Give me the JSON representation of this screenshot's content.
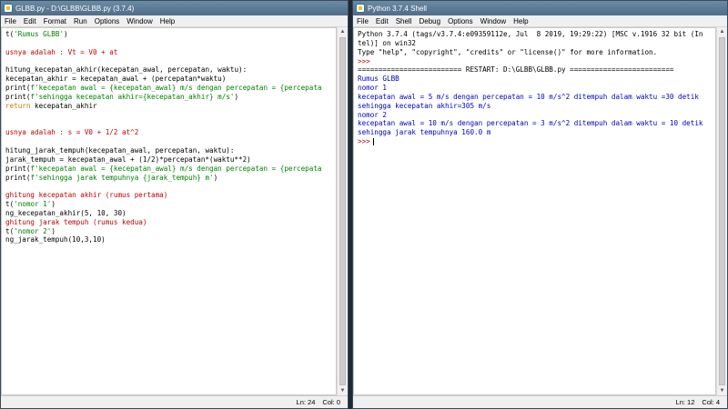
{
  "editor_window": {
    "title": "GLBB.py - D:\\GLBB\\GLBB.py (3.7.4)",
    "menu": [
      "File",
      "Edit",
      "Format",
      "Run",
      "Options",
      "Window",
      "Help"
    ],
    "lines": [
      [
        {
          "t": "t(",
          "c": "def"
        },
        {
          "t": "'Rumus GLBB'",
          "c": "str"
        },
        {
          "t": ")",
          "c": "def"
        }
      ],
      [],
      [
        {
          "t": "usnya adalah : Vt = V0 + at",
          "c": "cmt"
        }
      ],
      [],
      [
        {
          "t": "hitung_kecepatan_akhir(kecepatan_awal, percepatan, waktu):",
          "c": "def"
        }
      ],
      [
        {
          "t": "kecepatan_akhir = kecepatan_awal + (percepatan*waktu)",
          "c": "def"
        }
      ],
      [
        {
          "t": "print(",
          "c": "def"
        },
        {
          "t": "f'kecepatan awal = {kecepatan_awal} m/s dengan percepatan = {percepata",
          "c": "str"
        }
      ],
      [
        {
          "t": "print(",
          "c": "def"
        },
        {
          "t": "f'sehingga kecepatan akhir={kecepatan_akhir} m/s'",
          "c": "str"
        },
        {
          "t": ")",
          "c": "def"
        }
      ],
      [
        {
          "t": "return",
          "c": "kw"
        },
        {
          "t": " kecepatan_akhir",
          "c": "def"
        }
      ],
      [],
      [],
      [
        {
          "t": "usnya adalah : s = V0 + 1/2 at^2",
          "c": "cmt"
        }
      ],
      [],
      [
        {
          "t": "hitung_jarak_tempuh(kecepatan_awal, percepatan, waktu):",
          "c": "def"
        }
      ],
      [
        {
          "t": "jarak_tempuh = kecepatan_awal + (1/2)*percepatan*(waktu**2)",
          "c": "def"
        }
      ],
      [
        {
          "t": "print(",
          "c": "def"
        },
        {
          "t": "f'kecepatan awal = {kecepatan_awal} m/s dengan percepatan = {percepata",
          "c": "str"
        }
      ],
      [
        {
          "t": "print(",
          "c": "def"
        },
        {
          "t": "f'sehingga jarak tempuhnya {jarak_tempuh} m'",
          "c": "str"
        },
        {
          "t": ")",
          "c": "def"
        }
      ],
      [],
      [
        {
          "t": "ghitung kecepatan akhir (rumus pertama)",
          "c": "cmt"
        }
      ],
      [
        {
          "t": "t(",
          "c": "def"
        },
        {
          "t": "'nomor 1'",
          "c": "str"
        },
        {
          "t": ")",
          "c": "def"
        }
      ],
      [
        {
          "t": "ng_kecepatan_akhir(5, 10, 30)",
          "c": "def"
        }
      ],
      [
        {
          "t": "ghitung jarak tempuh (rumus kedua)",
          "c": "cmt"
        }
      ],
      [
        {
          "t": "t(",
          "c": "def"
        },
        {
          "t": "'nomor 2'",
          "c": "str"
        },
        {
          "t": ")",
          "c": "def"
        }
      ],
      [
        {
          "t": "ng_jarak_tempuh(10,3,10)",
          "c": "def"
        }
      ]
    ],
    "status": {
      "ln": "Ln: 24",
      "col": "Col: 0"
    }
  },
  "shell_window": {
    "title": "Python 3.7.4 Shell",
    "menu": [
      "File",
      "Edit",
      "Shell",
      "Debug",
      "Options",
      "Window",
      "Help"
    ],
    "lines": [
      [
        {
          "t": "Python 3.7.4 (tags/v3.7.4:e09359112e, Jul  8 2019, 19:29:22) [MSC v.1916 32 bit (In",
          "c": "def"
        }
      ],
      [
        {
          "t": "tel)] on win32",
          "c": "def"
        }
      ],
      [
        {
          "t": "Type \"help\", \"copyright\", \"credits\" or \"license()\" for more information.",
          "c": "def"
        }
      ],
      [
        {
          "t": ">>>",
          "c": "prompt"
        }
      ],
      [
        {
          "t": "========================= RESTART: D:\\GLBB\\GLBB.py =========================",
          "c": "def"
        }
      ],
      [
        {
          "t": "Rumus GLBB",
          "c": "out"
        }
      ],
      [
        {
          "t": "nomor 1",
          "c": "out"
        }
      ],
      [
        {
          "t": "kecepatan awal = 5 m/s dengan percepatan = 10 m/s^2 ditempuh dalam waktu =30 detik",
          "c": "out"
        }
      ],
      [
        {
          "t": "sehingga kecepatan akhir=305 m/s",
          "c": "out"
        }
      ],
      [
        {
          "t": "nomor 2",
          "c": "out"
        }
      ],
      [
        {
          "t": "kecepatan awal = 10 m/s dengan percepatan = 3 m/s^2 ditempuh dalam waktu = 10 detik",
          "c": "out"
        }
      ],
      [
        {
          "t": "sehingga jarak tempuhnya 160.0 m",
          "c": "out"
        }
      ],
      [
        {
          "t": ">>>",
          "c": "prompt"
        }
      ]
    ],
    "status": {
      "ln": "Ln: 12",
      "col": "Col: 4"
    }
  }
}
